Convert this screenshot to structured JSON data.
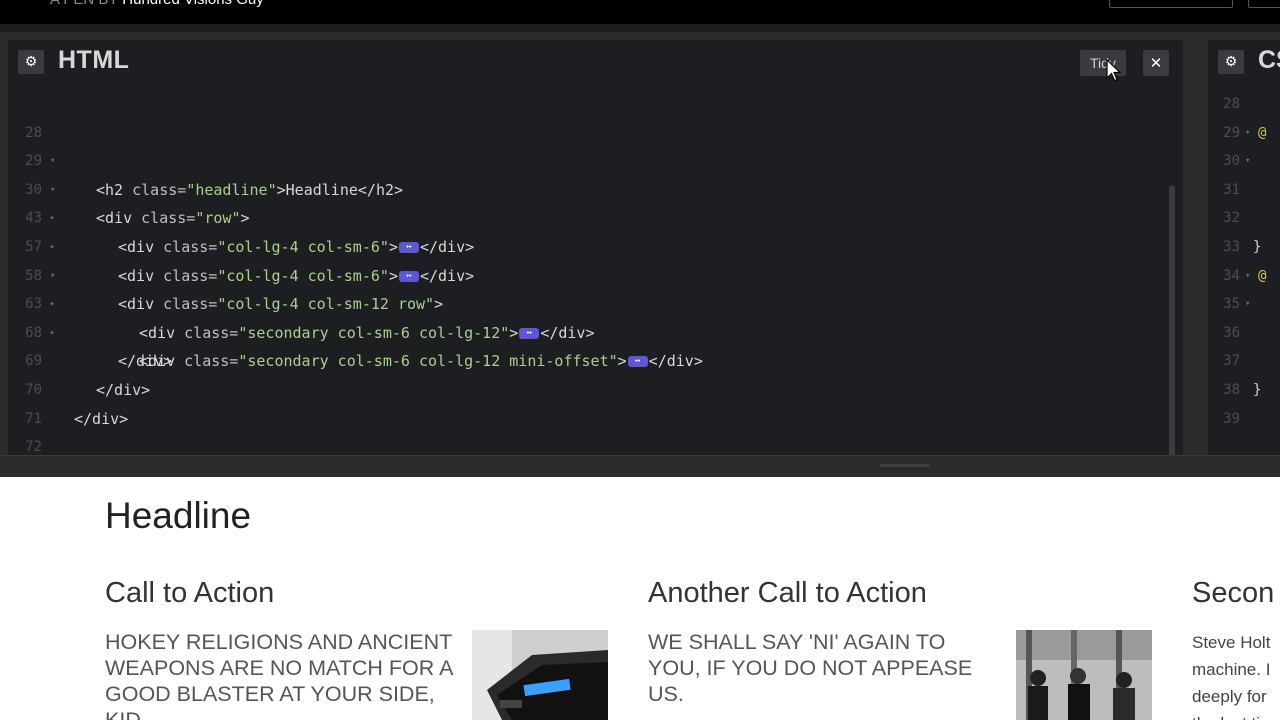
{
  "topbar": {
    "prefix": "A PEN BY",
    "author": "Hundred Visions Guy"
  },
  "html_pane": {
    "title": "HTML",
    "gear_icon": "gear-icon",
    "tidy_label": "Tidy",
    "close_icon": "close-icon",
    "lines": [
      {
        "num": "28",
        "fold": "▾"
      },
      {
        "num": "29",
        "fold": "▾"
      },
      {
        "num": "30",
        "fold": "▸"
      },
      {
        "num": "43",
        "fold": "▸"
      },
      {
        "num": "57",
        "fold": "▾"
      },
      {
        "num": "58",
        "fold": "▸"
      },
      {
        "num": "63",
        "fold": "▸"
      },
      {
        "num": "68",
        "fold": ""
      },
      {
        "num": "69",
        "fold": ""
      },
      {
        "num": "70",
        "fold": ""
      },
      {
        "num": "71",
        "fold": ""
      },
      {
        "num": "72",
        "fold": ""
      }
    ],
    "code": {
      "l28_tag_open": "<h2 ",
      "l28_attr": "class=",
      "l28_val": "\"headline\"",
      "l28_rest": ">Headline</h2>",
      "l29_tag": "<div ",
      "l29_attr": "class=",
      "l29_val": "\"row\"",
      "l29_rest": ">",
      "l30_tag": "<div ",
      "l30_attr": "class=",
      "l30_val": "\"col-lg-4 col-sm-6\"",
      "l30_rest": "</div>",
      "l43_val": "\"col-lg-4 col-sm-6\"",
      "l57_val": "\"col-lg-4 col-sm-12 row\"",
      "l58_val": "\"secondary col-sm-6 col-lg-12\"",
      "l63_val": "\"secondary col-sm-6 col-lg-12 mini-offset\"",
      "close_div": "</div>",
      "gt": ">",
      "collapsed_marker": "↔"
    }
  },
  "css_pane": {
    "title": "CS",
    "lines": [
      {
        "num": "28",
        "fold": "",
        "text": ""
      },
      {
        "num": "29",
        "fold": "▾",
        "text": "@"
      },
      {
        "num": "30",
        "fold": "▾",
        "text": ""
      },
      {
        "num": "31",
        "fold": "",
        "text": ""
      },
      {
        "num": "32",
        "fold": "",
        "text": ""
      },
      {
        "num": "33",
        "fold": "",
        "text": "}"
      },
      {
        "num": "34",
        "fold": "▾",
        "text": "@"
      },
      {
        "num": "35",
        "fold": "▾",
        "text": ""
      },
      {
        "num": "36",
        "fold": "",
        "text": ""
      },
      {
        "num": "37",
        "fold": "",
        "text": ""
      },
      {
        "num": "38",
        "fold": "",
        "text": "}"
      },
      {
        "num": "39",
        "fold": "",
        "text": ""
      }
    ]
  },
  "preview": {
    "headline": "Headline",
    "col1_title": "Call to Action",
    "col1_body": "HOKEY RELIGIONS AND ANCIENT WEAPONS ARE NO MATCH FOR A GOOD BLASTER AT YOUR SIDE, KID.",
    "col2_title": "Another Call to Action",
    "col2_body": "WE SHALL SAY 'NI' AGAIN TO YOU, IF YOU DO NOT APPEASE US.",
    "col3_title": "Secon",
    "col3_lines": [
      "Steve Holt",
      "machine. I",
      "deeply for",
      "the last tim"
    ]
  },
  "colors": {
    "editor_bg": "#1d1e22",
    "chrome_bg": "#2b2b2b",
    "string_green": "#a6d28a",
    "collapse_marker": "#5b57d6",
    "at_rule_yellow": "#e2c044"
  }
}
